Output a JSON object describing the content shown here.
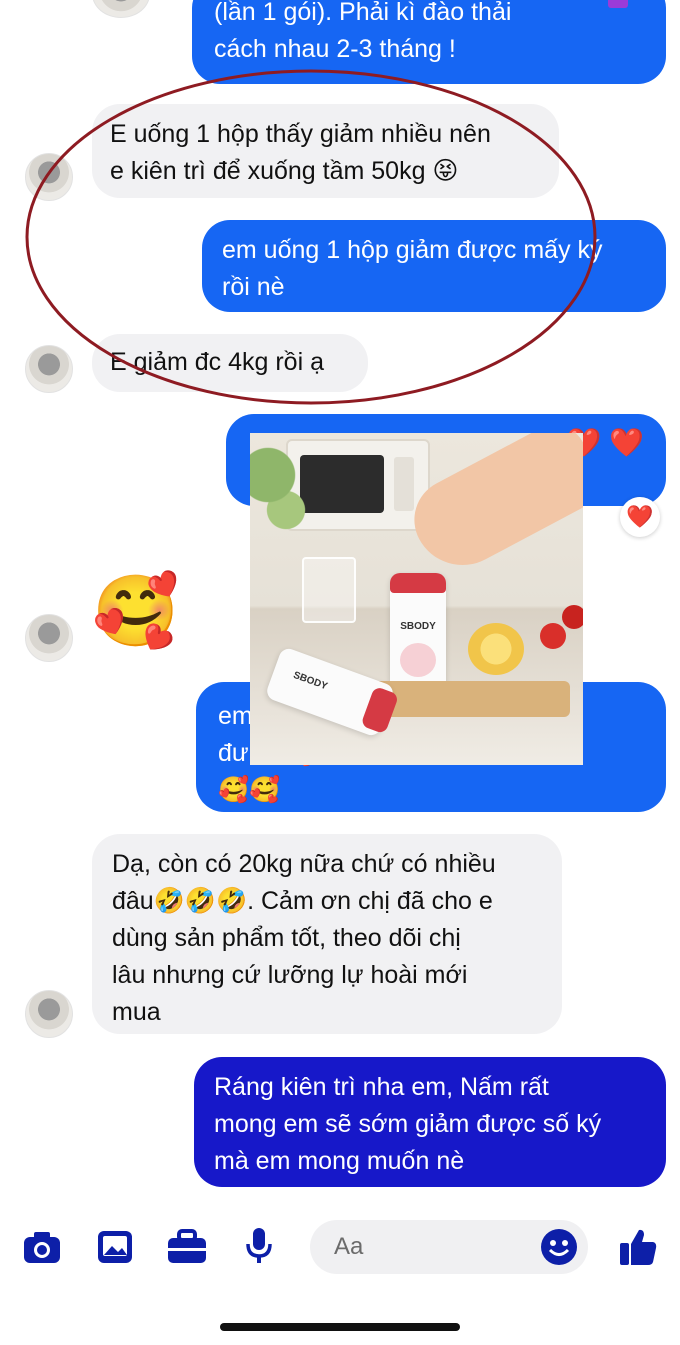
{
  "messages": [
    {
      "text": "(lần 1 gói). Phải kì đào thải\ncách nhau 2-3 tháng !"
    },
    {
      "text": "E uống 1 hộp thấy giảm nhiều nên\ne kiên trì để xuống tầm 50kg 😝"
    },
    {
      "text": "em uống 1 hộp giảm được mấy ký\nrồi nè"
    },
    {
      "text": "E giảm đc 4kg rồi ạ"
    },
    {
      "text": "❤️ ❤️"
    },
    {
      "reaction": "❤️"
    },
    {
      "emoji": "🥰"
    },
    {
      "text": "em\nđư                                              hé🥰\n🥰🥰"
    },
    {
      "text": "Dạ, còn có 20kg nữa chứ có nhiều\nđâu🤣🤣🤣. Cảm ơn chị đã cho e\ndùng sản phẩm tốt, theo dõi chị\nlâu nhưng cứ lưỡng lự hoài mới\nmua"
    },
    {
      "text": "Ráng kiên trì nha em, Nấm rất\nmong em sẽ sớm giảm được số ký\nmà em mong muốn nè"
    }
  ],
  "overlay_image": {
    "product_label": "SBODY",
    "product_label_2": "SBODY"
  },
  "composer": {
    "placeholder": "Aa"
  },
  "colors": {
    "outgoing": "#1666f3",
    "outgoing_dark": "#1718c9",
    "incoming": "#f1f1f3",
    "annotation_circle": "#8e1b22",
    "icon_blue": "#0d1fa8"
  },
  "icons": [
    "camera-icon",
    "image-icon",
    "briefcase-icon",
    "microphone-icon",
    "emoji-icon",
    "thumbs-up-icon"
  ]
}
